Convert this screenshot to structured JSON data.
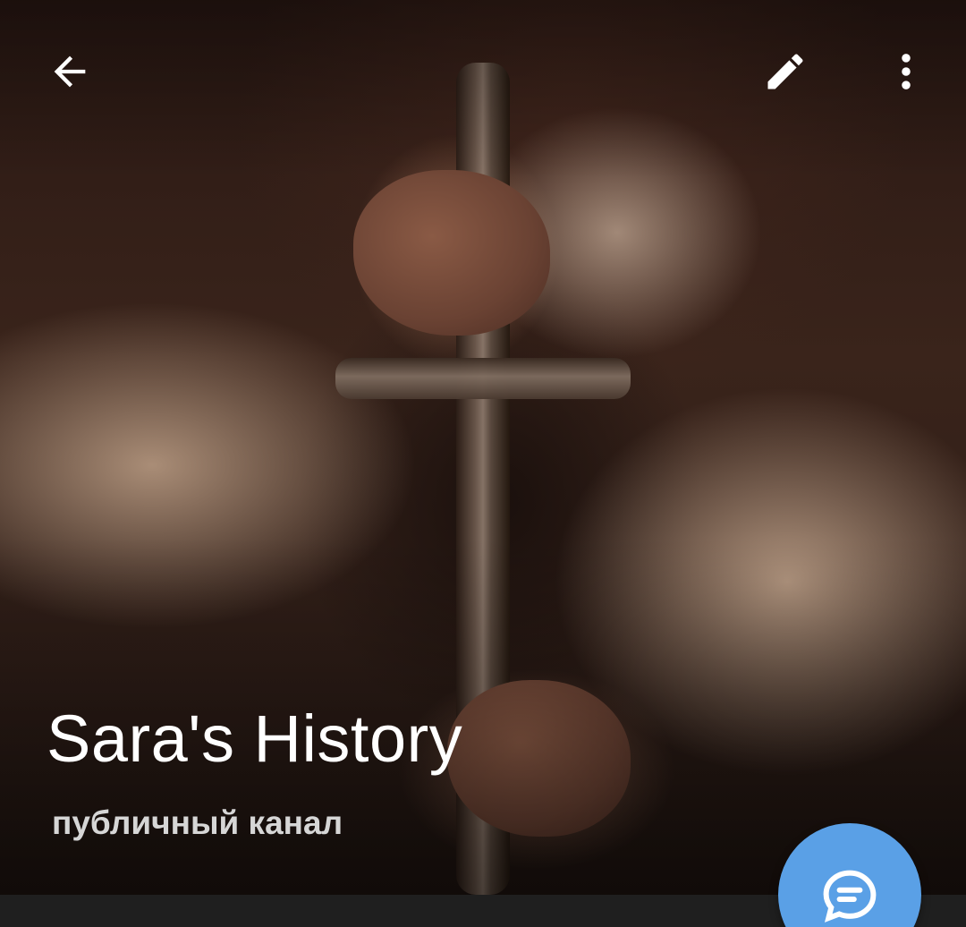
{
  "toolbar": {
    "back_icon": "arrow-back-icon",
    "edit_icon": "pencil-icon",
    "more_icon": "more-vertical-icon"
  },
  "channel": {
    "name": "Sara's History",
    "type": "публичный канал"
  },
  "fab": {
    "icon": "chat-bubble-icon",
    "color": "#5aa0e6"
  },
  "colors": {
    "title": "#ffffff",
    "subtitle": "#d6d6d6",
    "bottom_bar": "#1f1f1f"
  }
}
